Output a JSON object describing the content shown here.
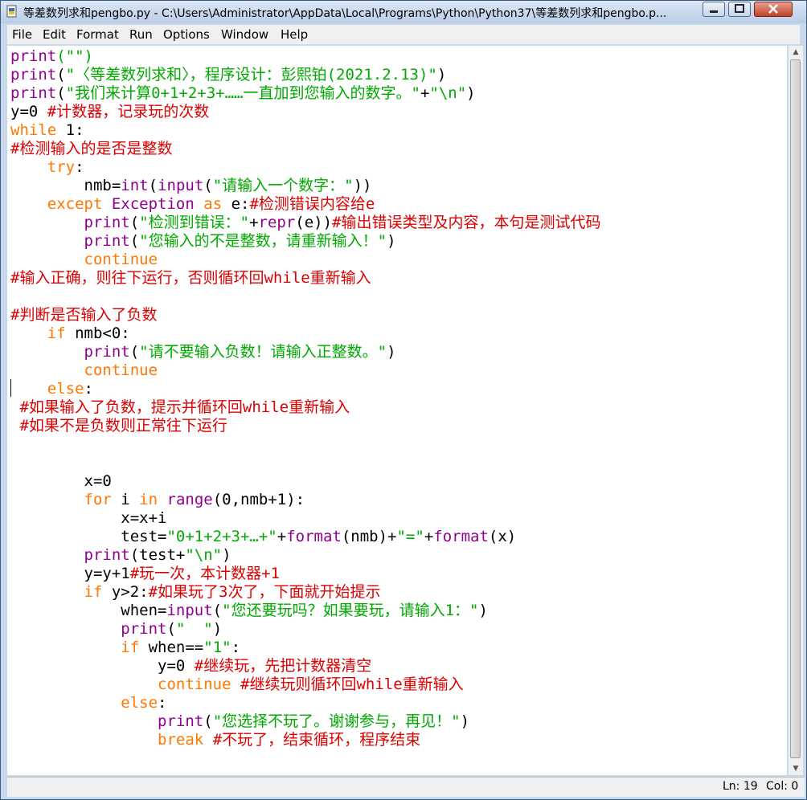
{
  "window": {
    "title": "等差数列求和pengbo.py - C:\\Users\\Administrator\\AppData\\Local\\Programs\\Python\\Python37\\等差数列求和pengbo.p..."
  },
  "menu": [
    "File",
    "Edit",
    "Format",
    "Run",
    "Options",
    "Window",
    "Help"
  ],
  "status": {
    "line": "Ln: 19",
    "col": "Col: 0"
  },
  "syntax_colors": {
    "keyword": "#ff7700",
    "builtin": "#900090",
    "string": "#00aa00",
    "comment": "#dd0000",
    "text": "#000000"
  },
  "code_lines": [
    [
      [
        "print",
        "bi"
      ],
      [
        "(\"\")",
        "st"
      ]
    ],
    [
      [
        "print",
        "bi"
      ],
      [
        "(",
        "n"
      ],
      [
        "\"〈等差数列求和〉，程序设计：彭熙铂(2021.2.13)\"",
        "st"
      ],
      [
        ")",
        "n"
      ]
    ],
    [
      [
        "print",
        "bi"
      ],
      [
        "(",
        "n"
      ],
      [
        "\"我们来计算0+1+2+3+……一直加到您输入的数字。\"",
        "st"
      ],
      [
        "+",
        "n"
      ],
      [
        "\"\\n\"",
        "st"
      ],
      [
        ")",
        "n"
      ]
    ],
    [
      [
        "y=0 ",
        "n"
      ],
      [
        "#计数器，记录玩的次数",
        "cm"
      ]
    ],
    [
      [
        "while",
        "kw"
      ],
      [
        " 1:",
        "n"
      ]
    ],
    [
      [
        "#检测输入的是否是整数",
        "cm"
      ]
    ],
    [
      [
        "    ",
        "n"
      ],
      [
        "try",
        "kw"
      ],
      [
        ":",
        "n"
      ]
    ],
    [
      [
        "        nmb=",
        "n"
      ],
      [
        "int",
        "bi"
      ],
      [
        "(",
        "n"
      ],
      [
        "input",
        "bi"
      ],
      [
        "(",
        "n"
      ],
      [
        "\"请输入一个数字：\"",
        "st"
      ],
      [
        "))",
        "n"
      ]
    ],
    [
      [
        "    ",
        "n"
      ],
      [
        "except",
        "kw"
      ],
      [
        " ",
        "n"
      ],
      [
        "Exception",
        "bi"
      ],
      [
        " ",
        "n"
      ],
      [
        "as",
        "kw"
      ],
      [
        " e:",
        "n"
      ],
      [
        "#检测错误内容给e",
        "cm"
      ]
    ],
    [
      [
        "        ",
        "n"
      ],
      [
        "print",
        "bi"
      ],
      [
        "(",
        "n"
      ],
      [
        "\"检测到错误：\"",
        "st"
      ],
      [
        "+",
        "n"
      ],
      [
        "repr",
        "bi"
      ],
      [
        "(e))",
        "n"
      ],
      [
        "#输出错误类型及内容，本句是测试代码",
        "cm"
      ]
    ],
    [
      [
        "        ",
        "n"
      ],
      [
        "print",
        "bi"
      ],
      [
        "(",
        "n"
      ],
      [
        "\"您输入的不是整数，请重新输入！\"",
        "st"
      ],
      [
        ")",
        "n"
      ]
    ],
    [
      [
        "        ",
        "n"
      ],
      [
        "continue",
        "kw"
      ]
    ],
    [
      [
        "#输入正确，则往下运行，否则循环回while重新输入",
        "cm"
      ]
    ],
    [
      [
        "",
        "n"
      ]
    ],
    [
      [
        "#判断是否输入了负数",
        "cm"
      ]
    ],
    [
      [
        "    ",
        "n"
      ],
      [
        "if",
        "kw"
      ],
      [
        " nmb<0:",
        "n"
      ]
    ],
    [
      [
        "        ",
        "n"
      ],
      [
        "print",
        "bi"
      ],
      [
        "(",
        "n"
      ],
      [
        "\"请不要输入负数！请输入正整数。\"",
        "st"
      ],
      [
        ")",
        "n"
      ]
    ],
    [
      [
        "        ",
        "n"
      ],
      [
        "continue",
        "kw"
      ]
    ],
    [
      [
        "    ",
        "n"
      ],
      [
        "else",
        "kw"
      ],
      [
        ":",
        "n"
      ]
    ],
    [
      [
        " ",
        "n"
      ],
      [
        "#如果输入了负数，提示并循环回while重新输入",
        "cm"
      ]
    ],
    [
      [
        " ",
        "n"
      ],
      [
        "#如果不是负数则正常往下运行",
        "cm"
      ]
    ],
    [
      [
        "",
        "n"
      ]
    ],
    [
      [
        "",
        "n"
      ]
    ],
    [
      [
        "        x=0",
        "n"
      ]
    ],
    [
      [
        "        ",
        "n"
      ],
      [
        "for",
        "kw"
      ],
      [
        " i ",
        "n"
      ],
      [
        "in",
        "kw"
      ],
      [
        " ",
        "n"
      ],
      [
        "range",
        "bi"
      ],
      [
        "(0,nmb+1):",
        "n"
      ]
    ],
    [
      [
        "            x=x+i",
        "n"
      ]
    ],
    [
      [
        "            test=",
        "n"
      ],
      [
        "\"0+1+2+3+…+\"",
        "st"
      ],
      [
        "+",
        "n"
      ],
      [
        "format",
        "bi"
      ],
      [
        "(nmb)+",
        "n"
      ],
      [
        "\"=\"",
        "st"
      ],
      [
        "+",
        "n"
      ],
      [
        "format",
        "bi"
      ],
      [
        "(x)",
        "n"
      ]
    ],
    [
      [
        "        ",
        "n"
      ],
      [
        "print",
        "bi"
      ],
      [
        "(test+",
        "n"
      ],
      [
        "\"\\n\"",
        "st"
      ],
      [
        ")",
        "n"
      ]
    ],
    [
      [
        "        y=y+1",
        "n"
      ],
      [
        "#玩一次，本计数器+1",
        "cm"
      ]
    ],
    [
      [
        "        ",
        "n"
      ],
      [
        "if",
        "kw"
      ],
      [
        " y>2:",
        "n"
      ],
      [
        "#如果玩了3次了，下面就开始提示",
        "cm"
      ]
    ],
    [
      [
        "            when=",
        "n"
      ],
      [
        "input",
        "bi"
      ],
      [
        "(",
        "n"
      ],
      [
        "\"您还要玩吗？如果要玩，请输入1：\"",
        "st"
      ],
      [
        ")",
        "n"
      ]
    ],
    [
      [
        "            ",
        "n"
      ],
      [
        "print",
        "bi"
      ],
      [
        "(",
        "n"
      ],
      [
        "\"  \"",
        "st"
      ],
      [
        ")",
        "n"
      ]
    ],
    [
      [
        "            ",
        "n"
      ],
      [
        "if",
        "kw"
      ],
      [
        " when==",
        "n"
      ],
      [
        "\"1\"",
        "st"
      ],
      [
        ":",
        "n"
      ]
    ],
    [
      [
        "                y=0 ",
        "n"
      ],
      [
        "#继续玩，先把计数器清空",
        "cm"
      ]
    ],
    [
      [
        "                ",
        "n"
      ],
      [
        "continue",
        "kw"
      ],
      [
        " ",
        "n"
      ],
      [
        "#继续玩则循环回while重新输入",
        "cm"
      ]
    ],
    [
      [
        "            ",
        "n"
      ],
      [
        "else",
        "kw"
      ],
      [
        ":",
        "n"
      ]
    ],
    [
      [
        "                ",
        "n"
      ],
      [
        "print",
        "bi"
      ],
      [
        "(",
        "n"
      ],
      [
        "\"您选择不玩了。谢谢参与，再见！\"",
        "st"
      ],
      [
        ")",
        "n"
      ]
    ],
    [
      [
        "                ",
        "n"
      ],
      [
        "break",
        "kw"
      ],
      [
        " ",
        "n"
      ],
      [
        "#不玩了，结束循环，程序结束",
        "cm"
      ]
    ]
  ]
}
